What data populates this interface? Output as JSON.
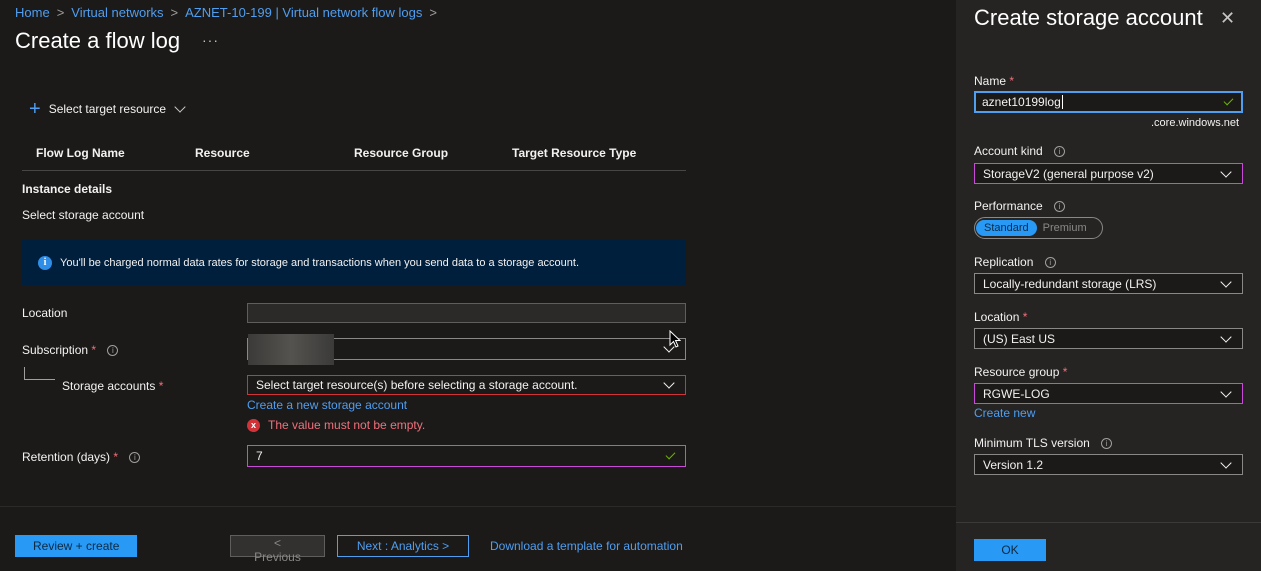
{
  "breadcrumb": {
    "home": "Home",
    "virtual_networks": "Virtual networks",
    "flow_logs": "AZNET-10-199 | Virtual network flow logs",
    "sep": ">"
  },
  "page": {
    "title": "Create a flow log",
    "more": "···",
    "select_target": "Select target resource"
  },
  "table": {
    "columns": [
      "Flow Log Name",
      "Resource",
      "Resource Group",
      "Target Resource Type"
    ]
  },
  "instance": {
    "section_title": "Instance details",
    "storage_title": "Select storage account",
    "info_icon": "i",
    "info_text": "You'll be charged normal data rates for storage and transactions when you send data to a storage account."
  },
  "form": {
    "location_label": "Location",
    "location_value": "",
    "subscription_label": "Subscription",
    "storage_label": "Storage accounts",
    "storage_value": "Select target resource(s) before selecting a storage account.",
    "create_storage_link": "Create a new storage account",
    "error_icon": "x",
    "error_message": "The value must not be empty.",
    "retention_label": "Retention (days)",
    "retention_value": "7",
    "required_mark": "*",
    "help_icon": "i"
  },
  "footer": {
    "review_create": "Review + create",
    "previous": "< Previous",
    "next": "Next : Analytics >",
    "download_template": "Download a template for automation"
  },
  "panel": {
    "title": "Create storage account",
    "close_icon": "✕",
    "name_label": "Name",
    "name_value": "aznet10199log",
    "name_suffix": ".core.windows.net",
    "kind_label": "Account kind",
    "kind_value": "StorageV2 (general purpose v2)",
    "performance_label": "Performance",
    "performance_options": [
      "Standard",
      "Premium"
    ],
    "replication_label": "Replication",
    "replication_value": "Locally-redundant storage (LRS)",
    "location_label": "Location",
    "location_value": "(US) East US",
    "rg_label": "Resource group",
    "rg_value": "RGWE-LOG",
    "create_new": "Create new",
    "tls_label": "Minimum TLS version",
    "tls_value": "Version 1.2",
    "ok": "OK"
  },
  "colors": {
    "background": "#1b1a19",
    "panel": "#252423",
    "accent": "#2899f5",
    "link": "#4f9ef0",
    "error": "#d13438",
    "focus_pink": "#c74bd7",
    "info_banner": "#001f3d"
  }
}
